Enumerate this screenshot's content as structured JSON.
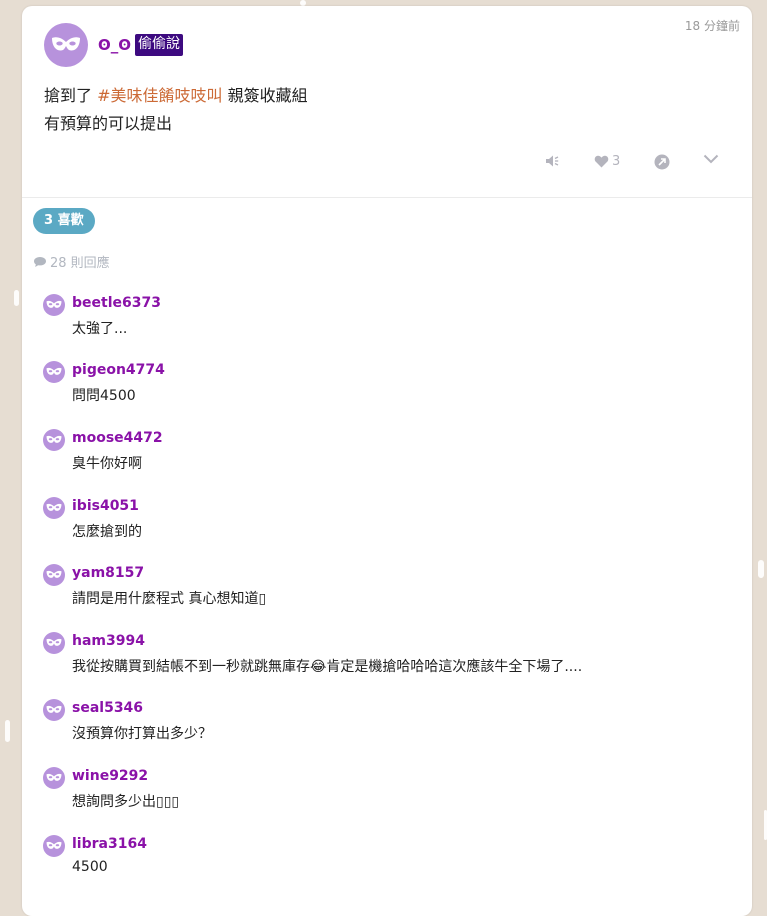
{
  "post": {
    "author": "ʘ_ʘ",
    "badge": "偷偷說",
    "time": "18 分鐘前",
    "line1_prefix": "搶到了",
    "hashtag": "#美味佳餚吱吱叫",
    "line1_suffix": "親簽收藏組",
    "line2": "有預算的可以提出"
  },
  "actions": {
    "like_count": "3"
  },
  "likes_label": "3 喜歡",
  "reply_count_label": "28 則回應",
  "comments": [
    {
      "name": "beetle6373",
      "text": "太強了..."
    },
    {
      "name": "pigeon4774",
      "text": "問問4500"
    },
    {
      "name": "moose4472",
      "text": "臭牛你好啊"
    },
    {
      "name": "ibis4051",
      "text": "怎麼搶到的"
    },
    {
      "name": "yam8157",
      "text": "請問是用什麼程式 真心想知道▯"
    },
    {
      "name": "ham3994",
      "text": "我從按購買到結帳不到一秒就跳無庫存😂肯定是機搶哈哈哈這次應該牛全下場了...."
    },
    {
      "name": "seal5346",
      "text": "沒預算你打算出多少？"
    },
    {
      "name": "wine9292",
      "text": "想詢問多少出▯▯▯"
    },
    {
      "name": "libra3164",
      "text": "4500"
    }
  ],
  "colors": {
    "avatar": "#b792dc",
    "username": "#8a12a8",
    "badge_bg": "#3d0a80",
    "hashtag": "#cc6a36",
    "likes_pill": "#5ba9c4",
    "background": "#e6ddd2"
  },
  "icons": {
    "avatar": "mask-icon",
    "mute": "speaker-mute-icon",
    "like": "heart-icon",
    "share": "share-icon",
    "more": "chevron-down-icon",
    "reply": "speech-bubble-icon"
  }
}
